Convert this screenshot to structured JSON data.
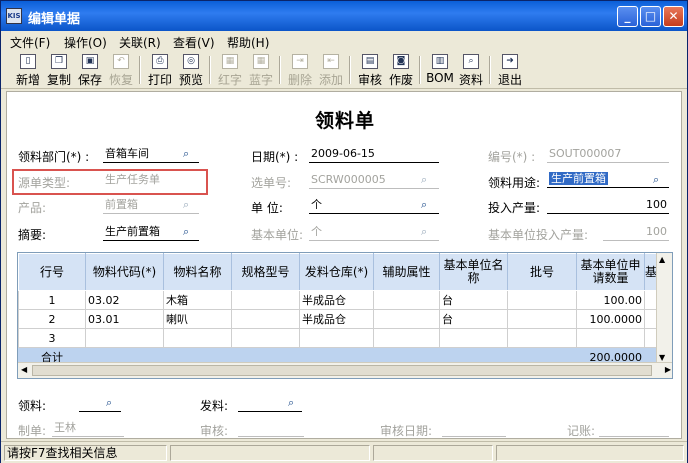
{
  "window": {
    "app_icon": "KIS",
    "title": "编辑单据",
    "min": "_",
    "max": "□",
    "close": "✕"
  },
  "menu": [
    "文件(F)",
    "操作(O)",
    "关联(R)",
    "查看(V)",
    "帮助(H)"
  ],
  "toolbar": [
    {
      "label": "新增",
      "icon": "new-icon",
      "glyph": "▯"
    },
    {
      "label": "复制",
      "icon": "copy-icon",
      "glyph": "❐"
    },
    {
      "label": "保存",
      "icon": "save-icon",
      "glyph": "▣"
    },
    {
      "label": "恢复",
      "icon": "undo-icon",
      "glyph": "↶"
    },
    {
      "label": "打印",
      "icon": "print-icon",
      "glyph": "⎙"
    },
    {
      "label": "预览",
      "icon": "preview-icon",
      "glyph": "◎"
    },
    {
      "label": "红字",
      "icon": "red-icon",
      "glyph": "▦"
    },
    {
      "label": "蓝字",
      "icon": "blue-icon",
      "glyph": "▦"
    },
    {
      "label": "删除",
      "icon": "delete-row-icon",
      "glyph": "⇥"
    },
    {
      "label": "添加",
      "icon": "add-row-icon",
      "glyph": "⇤"
    },
    {
      "label": "审核",
      "icon": "audit-icon",
      "glyph": "▤"
    },
    {
      "label": "作废",
      "icon": "void-icon",
      "glyph": "◙"
    },
    {
      "label": "BOM",
      "icon": "bom-icon",
      "glyph": "▥"
    },
    {
      "label": "资料",
      "icon": "data-icon",
      "glyph": "⌕"
    },
    {
      "label": "退出",
      "icon": "exit-icon",
      "glyph": "➜"
    }
  ],
  "doc_title": "领料单",
  "fields": {
    "dept_label": "领料部门(*) :",
    "dept_value": "音箱车间",
    "source_type_label": "源单类型:",
    "source_type_value": "生产任务单",
    "product_label": "产品:",
    "product_value": "前置箱",
    "summary_label": "摘要:",
    "summary_value": "生产前置箱",
    "date_label": "日期(*) :",
    "date_value": "2009-06-15",
    "select_no_label": "选单号:",
    "select_no_value": "SCRW000005",
    "unit_label": "单    位:",
    "unit_value": "个",
    "base_unit_label": "基本单位:",
    "base_unit_value": "个",
    "no_label": "编号(*) :",
    "no_value": "SOUT000007",
    "purpose_label": "领料用途:",
    "purpose_value": "生产前置箱",
    "input_qty_label": "投入产量:",
    "input_qty_value": "100",
    "base_input_qty_label": "基本单位投入产量:",
    "base_input_qty_value": "100"
  },
  "grid": {
    "headers": [
      "行号",
      "物料代码(*)",
      "物料名称",
      "规格型号",
      "发料仓库(*)",
      "辅助属性",
      "基本单位名称",
      "批号",
      "基本单位申请数量",
      "基"
    ],
    "rows": [
      [
        "1",
        "03.02",
        "木箱",
        "",
        "半成品仓",
        "",
        "台",
        "",
        "100.00",
        ""
      ],
      [
        "2",
        "03.01",
        "喇叭",
        "",
        "半成品仓",
        "",
        "台",
        "",
        "100.0000",
        ""
      ],
      [
        "3",
        "",
        "",
        "",
        "",
        "",
        "",
        "",
        "",
        ""
      ]
    ],
    "total_label": "合计",
    "total_value": "200.0000"
  },
  "footer": {
    "picker_label": "领料:",
    "issuer_label": "发料:",
    "maker_label": "制单:",
    "maker_value": "王林",
    "auditor_label": "审核:",
    "audit_date_label": "审核日期:",
    "posted_label": "记账:"
  },
  "status": {
    "hint": "请按F7查找相关信息"
  }
}
